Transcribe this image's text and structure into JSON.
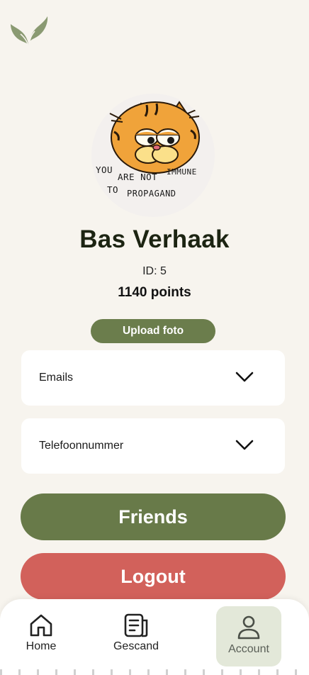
{
  "app": {
    "logo_icon": "leaf-logo-icon",
    "accent_color": "#687a49",
    "danger_color": "#d2615b"
  },
  "profile": {
    "avatar_caption_line1_a": "YOU",
    "avatar_caption_line1_b": "ARE NOT",
    "avatar_caption_line1_c": "IMMUNE",
    "avatar_caption_line2_a": "TO",
    "avatar_caption_line2_b": "PROPAGAND",
    "name": "Bas Verhaak",
    "id_text": "ID: 5",
    "points_text": "1140 points",
    "upload_label": "Upload foto"
  },
  "dropdowns": [
    {
      "label": "Emails",
      "icon": "chevron-down-icon"
    },
    {
      "label": "Telefoonnummer",
      "icon": "chevron-down-icon"
    }
  ],
  "actions": {
    "friends_label": "Friends",
    "logout_label": "Logout"
  },
  "nav": [
    {
      "label": "Home",
      "icon": "home-icon"
    },
    {
      "label": "Gescand",
      "icon": "scanned-list-icon"
    },
    {
      "label": "Account",
      "icon": "user-icon",
      "active": true
    }
  ]
}
